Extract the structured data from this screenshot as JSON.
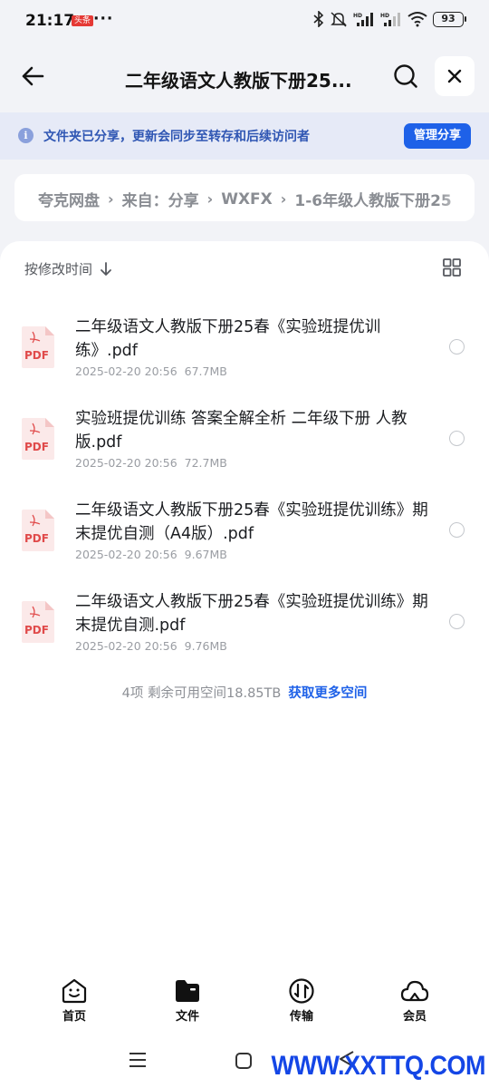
{
  "status_bar": {
    "time": "21:17",
    "badge": "头条",
    "dots": "···",
    "battery": "93"
  },
  "header": {
    "title": "二年级语文人教版下册25...",
    "back_icon": "arrow-left-icon",
    "search_icon": "search-icon",
    "close_icon": "close-icon"
  },
  "notice": {
    "icon": "info-icon",
    "text": "文件夹已分享，更新会同步至转存和后续访问者",
    "button_label": "管理分享",
    "accent_color": "#1e61e8"
  },
  "breadcrumb": {
    "items": [
      "夸克网盘",
      "来自：分享",
      "WXFX",
      "1-6年级人教版下册25"
    ]
  },
  "list": {
    "sort_label": "按修改时间",
    "sort_icon": "arrow-down-icon",
    "view_icon": "grid-view-icon",
    "files": [
      {
        "name": "二年级语文人教版下册25春《实验班提优训练》.pdf",
        "date": "2025-02-20 20:56",
        "size": "67.7MB",
        "icon_label": "PDF"
      },
      {
        "name": "实验班提优训练 答案全解全析 二年级下册 人教版.pdf",
        "date": "2025-02-20 20:56",
        "size": "72.7MB",
        "icon_label": "PDF"
      },
      {
        "name": "二年级语文人教版下册25春《实验班提优训练》期末提优自测（A4版）.pdf",
        "date": "2025-02-20 20:56",
        "size": "9.67MB",
        "icon_label": "PDF"
      },
      {
        "name": "二年级语文人教版下册25春《实验班提优训练》期末提优自测.pdf",
        "date": "2025-02-20 20:56",
        "size": "9.76MB",
        "icon_label": "PDF"
      }
    ],
    "summary": "4项 剩余可用空间18.85TB",
    "summary_link": "获取更多空间"
  },
  "bottom_nav": {
    "items": [
      {
        "label": "首页",
        "icon": "home-smile-icon"
      },
      {
        "label": "文件",
        "icon": "folder-icon"
      },
      {
        "label": "传输",
        "icon": "transfer-icon"
      },
      {
        "label": "会员",
        "icon": "cloud-icon"
      }
    ]
  },
  "watermark": "WWW.XXTTQ.COM"
}
